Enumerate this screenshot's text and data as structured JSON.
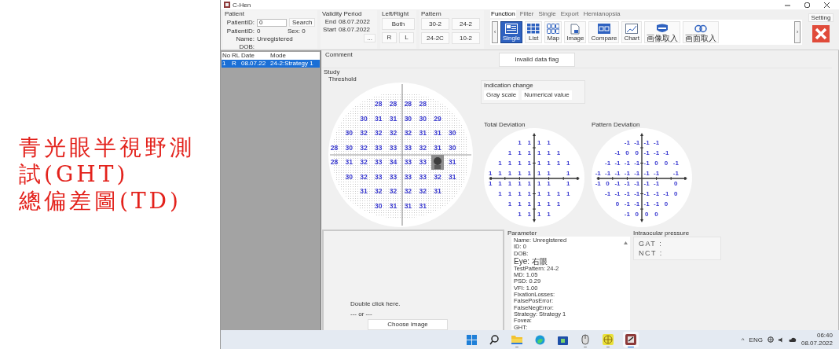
{
  "caption": {
    "lines": [
      "青光眼半視野測",
      "試(GHT)",
      "總偏差圖(TD)"
    ]
  },
  "window": {
    "title": "C-Hen"
  },
  "patient": {
    "label": "Patient",
    "id_field": {
      "label": "PatientID:",
      "value": "0"
    },
    "search_button": "Search",
    "id": {
      "label": "PatientID:",
      "value": "0"
    },
    "sex": "Sex: 0",
    "name": {
      "label": "Name:",
      "value": "Unregistered"
    },
    "dob": {
      "label": "DOB:"
    }
  },
  "validity_period": {
    "label": "Validity Period",
    "end": {
      "label": "End",
      "value": "08.07.2022"
    },
    "start": {
      "label": "Start",
      "value": "08.07.2022"
    },
    "more_button": "..."
  },
  "left_right": {
    "label": "Left/Right",
    "both_button": "Both",
    "side_buttons": [
      "R",
      "L"
    ]
  },
  "pattern": {
    "label": "Pattern",
    "buttons": [
      "30-2",
      "24-2",
      "24-2C",
      "10-2"
    ]
  },
  "ribbon": {
    "tabs": [
      {
        "label": "Function",
        "selected": true
      },
      {
        "label": "Filter",
        "selected": false
      },
      {
        "label": "Single",
        "selected": false
      },
      {
        "label": "Export",
        "selected": false
      },
      {
        "label": "Hemianopsia",
        "selected": false
      }
    ],
    "scroll_left": "‹",
    "scroll_right": "›",
    "tools": [
      {
        "kind": "single",
        "label": "Single",
        "selected": true
      },
      {
        "kind": "list",
        "label": "List",
        "selected": false
      },
      {
        "kind": "map",
        "label": "Map",
        "selected": false
      },
      {
        "kind": "image",
        "label": "Image",
        "selected": false
      },
      {
        "kind": "compare",
        "label": "Compare",
        "selected": false
      },
      {
        "kind": "chart",
        "label": "Chart",
        "selected": false
      },
      {
        "kind": "capture",
        "label": "画像取入",
        "selected": false
      },
      {
        "kind": "rings",
        "label": "画面取入",
        "selected": false
      }
    ]
  },
  "setting_button": "Setting",
  "study_list": {
    "columns": [
      "No",
      "RL",
      "Date",
      "Mode"
    ],
    "rows": [
      {
        "cells": [
          "1",
          "R",
          "08.07.22",
          "24-2:Strategy 1"
        ],
        "selected": true
      }
    ]
  },
  "comment": {
    "label": "Comment",
    "flag_button": "Invalid data flag"
  },
  "study": {
    "label": "Study",
    "threshold": {
      "title": "Threshold",
      "rows": [
        [
          null,
          null,
          null,
          "28",
          "28",
          "28",
          "28",
          null,
          null
        ],
        [
          null,
          null,
          "30",
          "31",
          "31",
          "30",
          "30",
          "29",
          null
        ],
        [
          null,
          "30",
          "32",
          "32",
          "32",
          "32",
          "31",
          "31",
          "30"
        ],
        [
          "28",
          "30",
          "32",
          "33",
          "33",
          "33",
          "32",
          "31",
          "30"
        ],
        [
          "28",
          "31",
          "32",
          "33",
          "34",
          "33",
          "33",
          {
            "kind": "blind_spot"
          },
          "31"
        ],
        [
          null,
          "30",
          "32",
          "33",
          "33",
          "33",
          "33",
          "32",
          "31"
        ],
        [
          null,
          null,
          "31",
          "32",
          "32",
          "32",
          "32",
          "31",
          null
        ],
        [
          null,
          null,
          null,
          "30",
          "31",
          "31",
          "31",
          null,
          null
        ]
      ]
    },
    "indication_change": {
      "label": "Indication change",
      "buttons": [
        "Gray scale",
        "Numerical value"
      ]
    },
    "total_deviation": {
      "title": "Total Deviation",
      "rows": [
        [
          null,
          null,
          null,
          "1",
          "1",
          "1",
          "1",
          null,
          null
        ],
        [
          null,
          null,
          "1",
          "1",
          "1",
          "1",
          "1",
          "1",
          null
        ],
        [
          null,
          "1",
          "1",
          "1",
          "1",
          "1",
          "1",
          "1",
          "1"
        ],
        [
          "1",
          "1",
          "1",
          "1",
          "1",
          "1",
          "1",
          null,
          "1"
        ],
        [
          "1",
          "1",
          "1",
          "1",
          "1",
          "1",
          "1",
          null,
          "1"
        ],
        [
          null,
          "1",
          "1",
          "1",
          "1",
          "1",
          "1",
          "1",
          "1"
        ],
        [
          null,
          null,
          "1",
          "1",
          "1",
          "1",
          "1",
          "1",
          null
        ],
        [
          null,
          null,
          null,
          "1",
          "1",
          "1",
          "1",
          null,
          null
        ]
      ]
    },
    "pattern_deviation": {
      "title": "Pattern Deviation",
      "rows": [
        [
          null,
          null,
          null,
          "-1",
          "-1",
          "-1",
          "-1",
          null,
          null
        ],
        [
          null,
          null,
          "-1",
          "0",
          "0",
          "-1",
          "-1",
          "-1",
          null
        ],
        [
          null,
          "-1",
          "-1",
          "-1",
          "-1",
          "-1",
          "0",
          "0",
          "-1"
        ],
        [
          "-1",
          "-1",
          "-1",
          "-1",
          "-1",
          "-1",
          "-1",
          null,
          "-1"
        ],
        [
          "-1",
          "0",
          "-1",
          "-1",
          "-1",
          "-1",
          "-1",
          null,
          "0"
        ],
        [
          null,
          "-1",
          "-1",
          "-1",
          "-1",
          "-1",
          "-1",
          "-1",
          "0"
        ],
        [
          null,
          null,
          "0",
          "-1",
          "-1",
          "-1",
          "-1",
          "0",
          null
        ],
        [
          null,
          null,
          null,
          "-1",
          "0",
          "0",
          "0",
          null,
          null
        ]
      ]
    }
  },
  "image_panel": {
    "hint": "Double click here.",
    "separator": "--- or ---",
    "choose_button": "Choose image"
  },
  "parameter": {
    "label": "Parameter",
    "lines": [
      "Name: Unregistered",
      "ID: 0",
      "DOB:",
      "Eye: 右眼",
      "TestPattern: 24-2",
      "MD: 1.05",
      "PSD: 0.29",
      "VFI: 1.00",
      "FixationLosses:",
      "FalsePosError:",
      "FalseNegError:",
      "Strategy: Strategy 1",
      "Fovea:",
      "GHT:"
    ]
  },
  "intraocular_pressure": {
    "label": "Intraocular pressure",
    "lines": [
      "GAT :",
      "NCT :"
    ]
  },
  "taskbar": {
    "apps": [
      {
        "kind": "start",
        "running": false,
        "active": false
      },
      {
        "kind": "search",
        "running": false,
        "active": false
      },
      {
        "kind": "folder",
        "running": true,
        "active": false
      },
      {
        "kind": "browser",
        "running": false,
        "active": false
      },
      {
        "kind": "store",
        "running": false,
        "active": false
      },
      {
        "kind": "mouse",
        "running": true,
        "active": false
      },
      {
        "kind": "globe",
        "running": true,
        "active": false
      },
      {
        "kind": "app",
        "running": true,
        "active": true
      }
    ],
    "chevron": "^",
    "language": "ENG",
    "time": "06:40",
    "date": "08.07.2022"
  }
}
